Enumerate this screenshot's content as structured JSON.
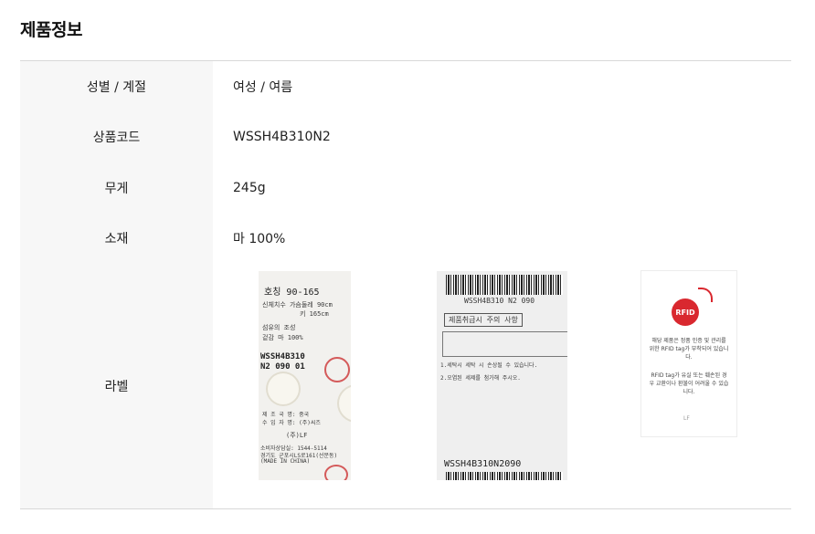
{
  "section_title": "제품정보",
  "rows": [
    {
      "label": "성별 / 계절",
      "value": "여성 / 여름"
    },
    {
      "label": "상품코드",
      "value": "WSSH4B310N2"
    },
    {
      "label": "무게",
      "value": "245g"
    },
    {
      "label": "소재",
      "value": "마 100%"
    }
  ],
  "label_row": {
    "label": "라벨",
    "tag1": {
      "lines": [
        "호칭  90-165",
        "신체치수 가슴둘레  90cm",
        "키  165cm",
        "섬유의 조성",
        "겉감   마   100%",
        "WSSH4B310",
        "N2 090 01",
        "제 조 국 명: 중국",
        "수 입 자 명: (주)씨즈"
      ],
      "brand": "(주)LF",
      "footer": [
        "소비자상담실: 1544-5114",
        "경기도 군포시LS로161(선문동)",
        "(MADE IN CHINA)"
      ]
    },
    "tag2": {
      "header": "WSSH4B310 N2 090",
      "care_title": "제품취급시 주의 사항",
      "care_lines": [
        "1.세탁시 세탁 시 손상될 수 있습니다.",
        "2.오염된 세제를 첨가해 주시오."
      ],
      "code": "WSSH4B310N2090"
    },
    "tag3": {
      "rfid_logo": "RFID",
      "text1": "해당 제품은 정품 인증 및 관리를 위한 RFID tag가 부착되어 있습니다.",
      "text2": "RFID tag가 유실 또는 훼손된 경우 교환이나 환불이 어려울 수 있습니다.",
      "brand": "LF"
    }
  }
}
